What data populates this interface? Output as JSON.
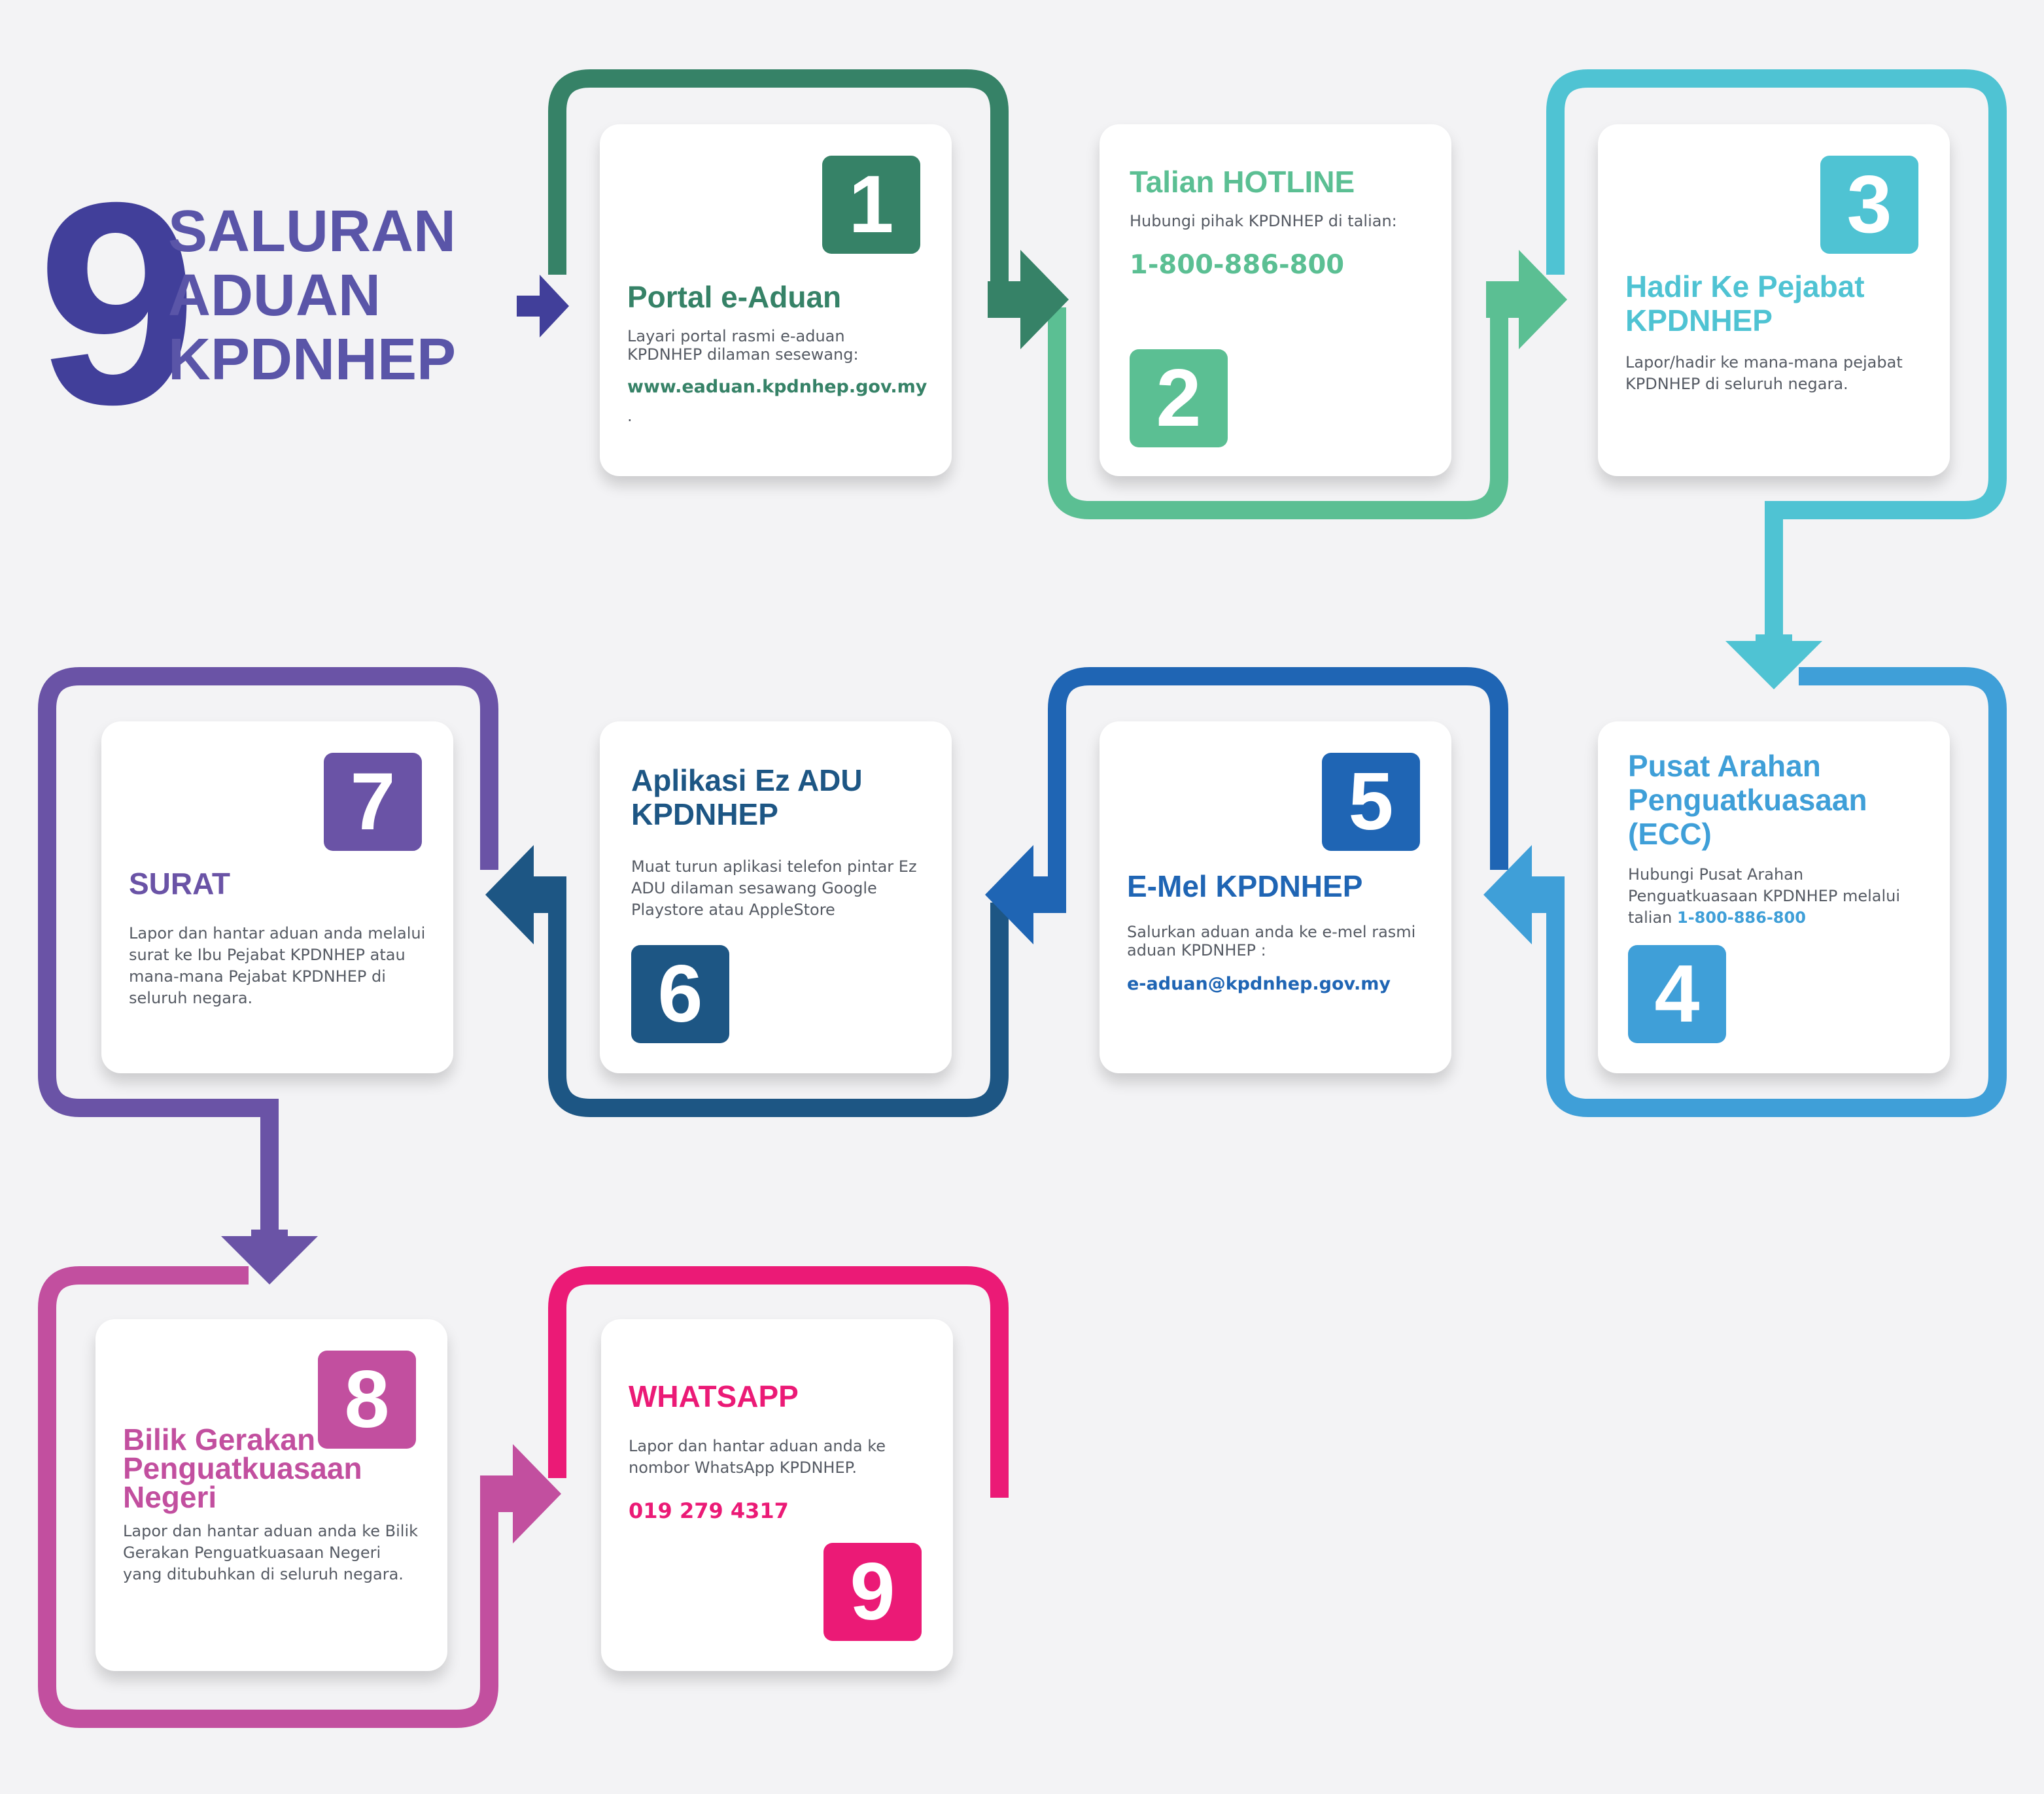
{
  "headline": {
    "number": "9",
    "line1": "SALURAN",
    "line2": "ADUAN",
    "line3": "KPDNHEP"
  },
  "colors": {
    "step1": "#368267",
    "step2": "#5bbf93",
    "step3": "#4fc3d3",
    "step4": "#3f9fd8",
    "step5": "#1f65b4",
    "step6": "#1d5684",
    "step7": "#6a53a6",
    "step8": "#c24f9f",
    "step9": "#eb1a76",
    "headline": "#413f9a"
  },
  "channels": [
    {
      "number": "1",
      "title": "Portal e-Aduan",
      "description": "Layari portal rasmi e-aduan KPDNHEP dilaman sesewang:",
      "highlight": "www.eaduan.kpdnhep.gov.my",
      "trailing": "."
    },
    {
      "number": "2",
      "title": "Talian HOTLINE",
      "description": "Hubungi pihak KPDNHEP di talian:",
      "highlight": "1-800-886-800"
    },
    {
      "number": "3",
      "title": "Hadir Ke Pejabat KPDNHEP",
      "description": "Lapor/hadir ke mana-mana pejabat KPDNHEP di seluruh negara."
    },
    {
      "number": "4",
      "title": "Pusat Arahan Penguatkuasaan (ECC)",
      "description": "Hubungi  Pusat Arahan Penguatkuasaan KPDNHEP melalui talian",
      "highlight": "1-800-886-800"
    },
    {
      "number": "5",
      "title": "E-Mel KPDNHEP",
      "description": "Salurkan aduan anda ke e-mel rasmi aduan KPDNHEP :",
      "highlight": "e-aduan@kpdnhep.gov.my"
    },
    {
      "number": "6",
      "title": "Aplikasi Ez ADU KPDNHEP",
      "description": "Muat turun aplikasi telefon pintar Ez ADU dilaman sesawang Google Playstore atau AppleStore"
    },
    {
      "number": "7",
      "title": "SURAT",
      "description": "Lapor dan hantar aduan anda melalui surat ke Ibu Pejabat KPDNHEP atau mana-mana Pejabat KPDNHEP di seluruh negara."
    },
    {
      "number": "8",
      "title": "Bilik Gerakan Penguatkuasaan Negeri",
      "description": "Lapor dan hantar aduan anda ke Bilik Gerakan Penguatkuasaan Negeri yang ditubuhkan di seluruh negara."
    },
    {
      "number": "9",
      "title": "WHATSAPP",
      "description": "Lapor dan hantar aduan anda ke nombor WhatsApp KPDNHEP.",
      "highlight": "019 279 4317"
    }
  ]
}
